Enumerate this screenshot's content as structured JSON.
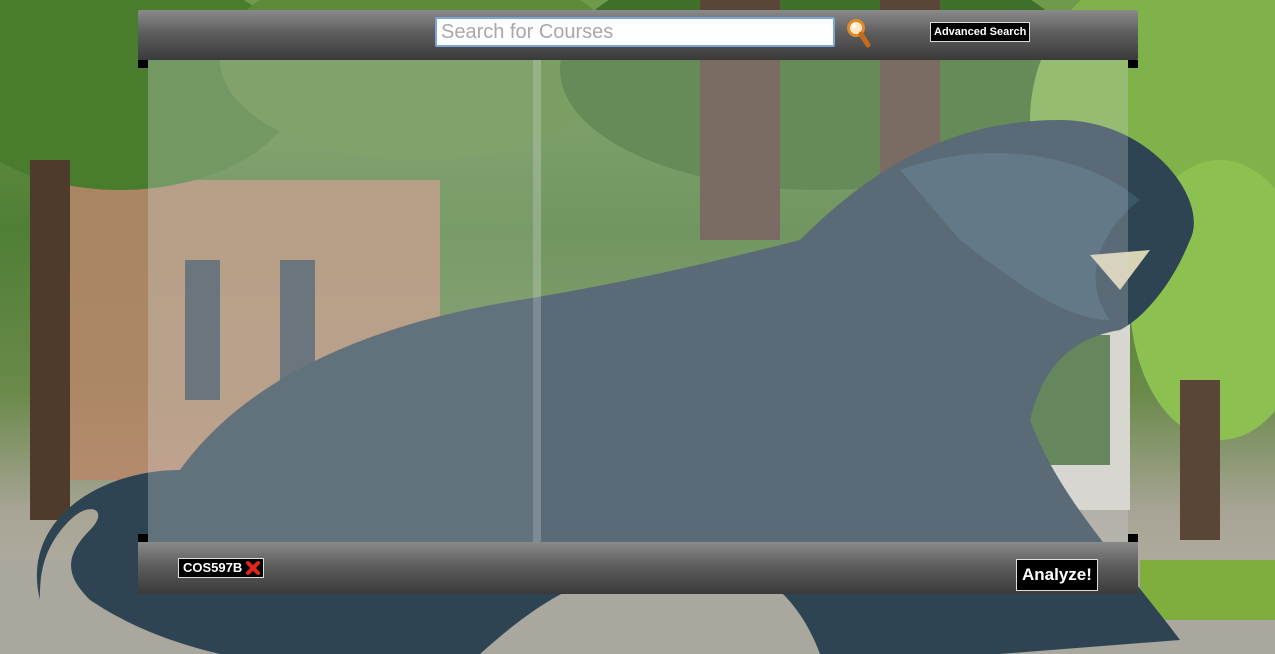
{
  "search": {
    "placeholder": "Search for Courses",
    "value": ""
  },
  "toolbar": {
    "advanced_search_label": "Advanced Search",
    "search_icon": "magnifier-icon"
  },
  "selected_courses": [
    {
      "code": "COS597B",
      "remove_icon": "red-x-icon"
    }
  ],
  "actions": {
    "analyze_label": "Analyze!"
  },
  "colors": {
    "bar_top": "#8a8a8a",
    "bar_bottom": "#3a3a3a",
    "input_border": "#7aa6d8",
    "remove_red": "#e0261b",
    "button_bg": "#000000"
  }
}
